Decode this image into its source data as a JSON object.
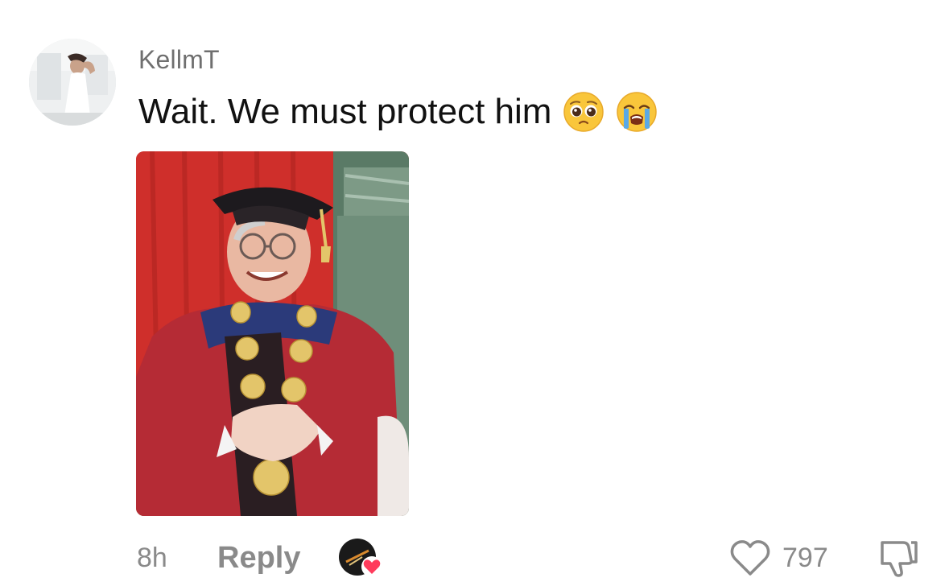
{
  "comment": {
    "username": "KellmT",
    "text": "Wait. We must protect him",
    "emojis": [
      "pleading-face-icon",
      "loudly-crying-face-icon"
    ],
    "time": "8h",
    "reply_label": "Reply",
    "like_count": "797"
  },
  "colors": {
    "username": "#6f6f6f",
    "text": "#111111",
    "meta": "#8a8a8a",
    "heart_badge": "#ff3b5c"
  }
}
